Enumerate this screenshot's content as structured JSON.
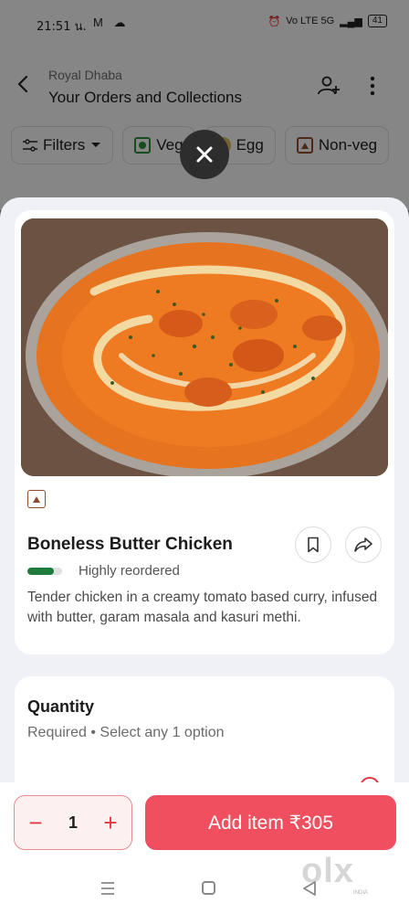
{
  "status_bar": {
    "time": "21:51 น.",
    "app_icons": "M ☁",
    "network": "Vo LTE 5G",
    "battery": "41"
  },
  "header": {
    "restaurant": "Royal Dhaba",
    "title": "Your Orders and Collections"
  },
  "filters": {
    "filters_label": "Filters",
    "veg_label": "Veg",
    "egg_label": "Egg",
    "nonveg_label": "Non-veg"
  },
  "dish": {
    "name": "Boneless Butter Chicken",
    "badge": "Highly reordered",
    "reorder_level": 0.75,
    "description": "Tender chicken in a creamy tomato based curry, infused with butter, garam masala and kasuri methi.",
    "food_type": "non-veg"
  },
  "quantity": {
    "title": "Quantity",
    "subtitle": "Required • Select any 1 option"
  },
  "cart": {
    "count": "1",
    "decrement_symbol": "−",
    "increment_symbol": "+",
    "add_label": "Add item ₹305"
  },
  "watermark": {
    "text": "olx",
    "sub": "INDIA"
  },
  "colors": {
    "accent": "#ef4f5f",
    "veg_green": "#2a8a3a",
    "nonveg_brown": "#8c4a2f",
    "reorder_green": "#1f7a3d"
  },
  "icons": [
    "back-arrow-icon",
    "group-add-icon",
    "more-vertical-icon",
    "filter-sliders-icon",
    "chevron-down-icon",
    "close-icon",
    "bookmark-icon",
    "share-icon",
    "nav-menu-icon",
    "nav-home-icon",
    "nav-back-icon"
  ]
}
